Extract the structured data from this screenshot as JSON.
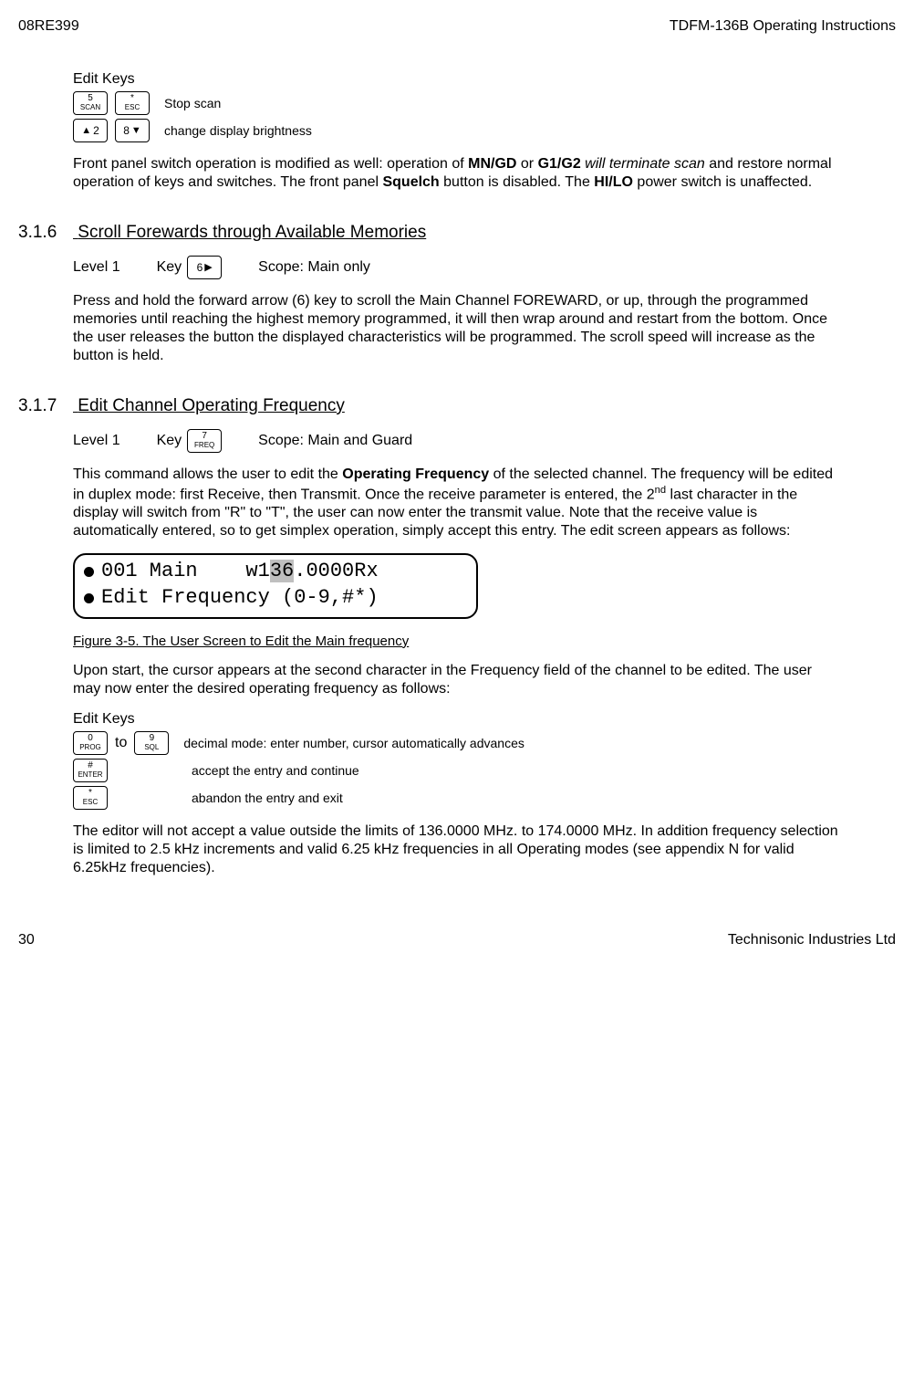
{
  "header": {
    "left": "08RE399",
    "right": "TDFM-136B Operating Instructions"
  },
  "sec_edit_keys_1": {
    "title": "Edit Keys",
    "row1_desc": "Stop scan",
    "row2_desc": "change display brightness",
    "key5_top": "5",
    "key5_bot": "SCAN",
    "keystar_top": "*",
    "keystar_bot": "ESC",
    "key2_num": "2",
    "key8_num": "8"
  },
  "para_front_panel_start": "Front panel switch operation is modified as well: operation of ",
  "para_front_panel_mngd": "MN/GD",
  "para_front_panel_or": " or ",
  "para_front_panel_g1g2": "G1/G2",
  "para_front_panel_will": " will terminate scan",
  "para_front_panel_line2a": " and restore normal operation of keys and switches. The front panel ",
  "para_front_panel_squelch": "Squelch",
  "para_front_panel_line2b": " button is disabled. The ",
  "para_front_panel_hilo": "HI/LO",
  "para_front_panel_end": " power switch is unaffected.",
  "sec316": {
    "num": "3.1.6",
    "title": "Scroll Forewards through Available Memories",
    "level": "Level 1",
    "key_label": "Key",
    "key6": "6",
    "scope": "Scope: Main only",
    "para": "Press and hold the forward arrow (6) key to scroll the Main Channel FOREWARD, or up, through the programmed memories until reaching the highest memory programmed, it will then wrap around and restart from the bottom. Once the user releases the button the displayed characteristics will be programmed. The scroll speed will increase as the button is held."
  },
  "sec317": {
    "num": "3.1.7",
    "title": "Edit Channel Operating Frequency",
    "level": "Level 1",
    "key_label": "Key",
    "key7_top": "7",
    "key7_bot": "FREQ",
    "scope": "Scope: Main and Guard",
    "para1_a": "This command allows the user to edit the ",
    "para1_op": "Operating Frequency",
    "para1_b": " of the selected channel. The frequency will be edited in duplex mode: first Receive, then Transmit. Once the receive parameter is entered, the 2",
    "para1_nd": "nd",
    "para1_c": " last character in the display will switch from \"R\" to \"T\", the user can now enter the transmit value. Note that the receive value is automatically entered, so to get simplex operation, simply accept this entry. The edit screen appears as follows:"
  },
  "display": {
    "line1_a": "001 Main    w1",
    "line1_hl": "36",
    "line1_b": ".0000Rx",
    "line2": "Edit Frequency (0-9,#*)"
  },
  "figure_caption": "Figure 3-5. The User Screen to Edit the Main frequency",
  "para_upon_start": "Upon start, the cursor appears at the second character in the Frequency field of the channel to be edited. The user may now enter the desired operating frequency as follows:",
  "sec_edit_keys_2": {
    "title": "Edit Keys",
    "key0_top": "0",
    "key0_bot": "PROG",
    "to": " to ",
    "key9_top": "9",
    "key9_bot": "SQL",
    "desc1": "decimal mode: enter number, cursor automatically advances",
    "keyhash_top": "#",
    "keyhash_bot": "ENTER",
    "desc2": "accept the entry and continue",
    "keystar_top": "*",
    "keystar_bot": "ESC",
    "desc3": "abandon the entry and exit"
  },
  "para_last": "The editor will not accept a value outside the limits of 136.0000 MHz. to 174.0000 MHz. In addition frequency selection is limited to 2.5 kHz increments and valid  6.25 kHz frequencies in all Operating modes (see appendix N for valid 6.25kHz frequencies).",
  "footer": {
    "page": "30",
    "company": "Technisonic Industries Ltd"
  }
}
